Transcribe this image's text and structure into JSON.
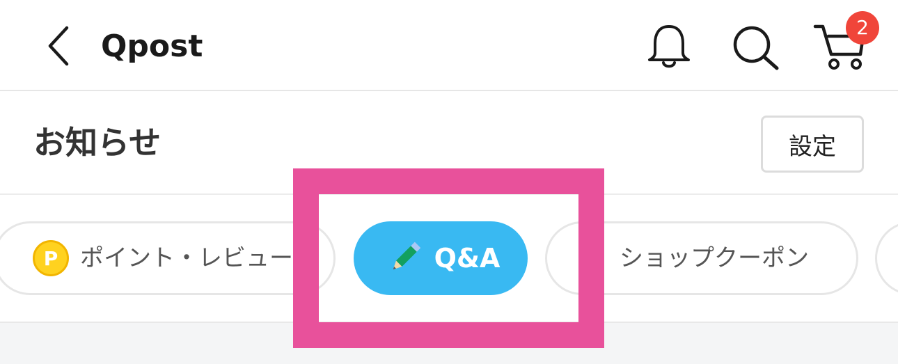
{
  "header": {
    "title": "Qpost",
    "back_icon": "chevron-left-icon",
    "bell_icon": "bell-icon",
    "search_icon": "search-icon",
    "cart_icon": "cart-icon",
    "cart_badge_count": "2",
    "badge_color": "#f0453a"
  },
  "section": {
    "title": "お知らせ",
    "settings_label": "設定"
  },
  "chips": {
    "points": {
      "icon": "point-coin-icon",
      "icon_text": "P",
      "label": "ポイント・レビュー"
    },
    "qa": {
      "icon": "pencil-icon",
      "label": "Q&A",
      "selected": true,
      "color": "#39b9f2"
    },
    "coupon": {
      "icon": "ticket-icon",
      "label": "ショップクーポン"
    }
  },
  "highlight": {
    "color": "#e8519b"
  }
}
